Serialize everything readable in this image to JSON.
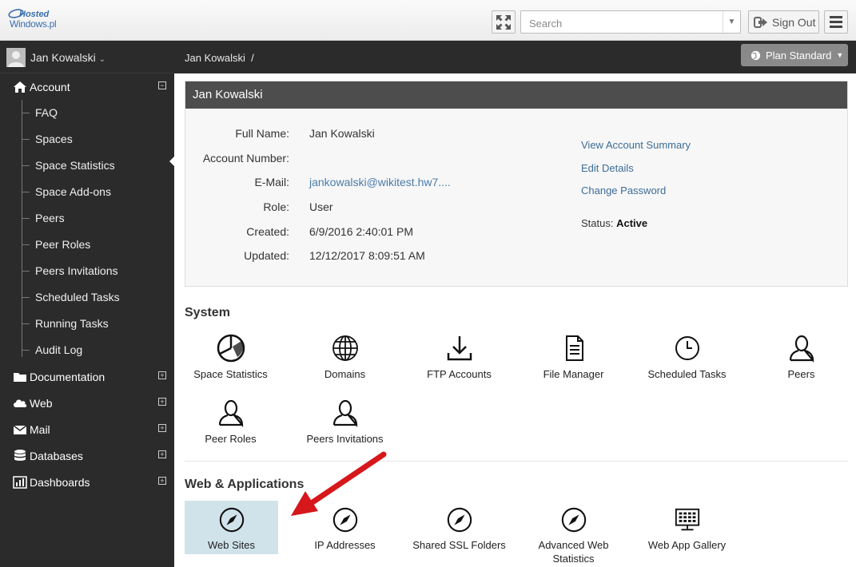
{
  "brand": {
    "logo_line1": "Hosted",
    "logo_line2": "Windows.pl"
  },
  "topbar": {
    "search_placeholder": "Search",
    "sign_out_label": "Sign Out"
  },
  "user": {
    "name": "Jan Kowalski"
  },
  "breadcrumb": {
    "text": "Jan Kowalski",
    "separator": "/"
  },
  "plan_button": {
    "label": "Plan Standard"
  },
  "sidebar": {
    "account": {
      "label": "Account",
      "toggle": "−",
      "items": [
        "FAQ",
        "Spaces",
        "Space Statistics",
        "Space Add-ons",
        "Peers",
        "Peer Roles",
        "Peers Invitations",
        "Scheduled Tasks",
        "Running Tasks",
        "Audit Log"
      ]
    },
    "sections": [
      {
        "label": "Documentation",
        "icon": "folder-icon",
        "toggle": "+"
      },
      {
        "label": "Web",
        "icon": "cloud-icon",
        "toggle": "+"
      },
      {
        "label": "Mail",
        "icon": "envelope-icon",
        "toggle": "+"
      },
      {
        "label": "Databases",
        "icon": "database-icon",
        "toggle": "+"
      },
      {
        "label": "Dashboards",
        "icon": "bar-chart-icon",
        "toggle": "+"
      }
    ]
  },
  "account_panel": {
    "title": "Jan Kowalski",
    "fields": [
      {
        "label": "Full Name:",
        "value": "Jan Kowalski"
      },
      {
        "label": "Account Number:",
        "value": ""
      },
      {
        "label": "E-Mail:",
        "value": "jankowalski@wikitest.hw7...."
      },
      {
        "label": "Role:",
        "value": "User"
      },
      {
        "label": "Created:",
        "value": "6/9/2016 2:40:01 PM"
      },
      {
        "label": "Updated:",
        "value": "12/12/2017 8:09:51 AM"
      }
    ],
    "links": [
      "View Account Summary",
      "Edit Details",
      "Change Password"
    ],
    "status_label": "Status:",
    "status_value": "Active"
  },
  "system": {
    "title": "System",
    "tiles": [
      {
        "label": "Space Statistics",
        "icon": "pie-chart-icon"
      },
      {
        "label": "Domains",
        "icon": "globe-icon"
      },
      {
        "label": "FTP Accounts",
        "icon": "download-icon"
      },
      {
        "label": "File Manager",
        "icon": "document-icon"
      },
      {
        "label": "Scheduled Tasks",
        "icon": "clock-icon"
      },
      {
        "label": "Peers",
        "icon": "user-icon"
      },
      {
        "label": "Peer Roles",
        "icon": "user-icon"
      },
      {
        "label": "Peers Invitations",
        "icon": "user-icon"
      }
    ]
  },
  "web_apps": {
    "title": "Web & Applications",
    "tiles": [
      {
        "label": "Web Sites",
        "icon": "compass-icon",
        "selected": true
      },
      {
        "label": "IP Addresses",
        "icon": "compass-icon"
      },
      {
        "label": "Shared SSL Folders",
        "icon": "compass-icon"
      },
      {
        "label": "Advanced Web Statistics",
        "icon": "compass-icon"
      },
      {
        "label": "Web App Gallery",
        "icon": "monitor-grid-icon"
      }
    ]
  },
  "colors": {
    "sidebar_bg": "#2b2b2b",
    "highlight_tile": "#d0e3ea",
    "link": "#3d6d97",
    "annotation_arrow": "#d6171b"
  }
}
